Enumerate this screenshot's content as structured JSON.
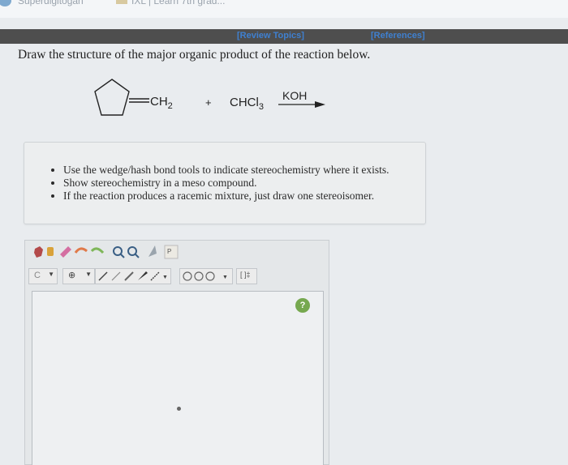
{
  "browser_tabs": [
    {
      "label": "Superdigitogan"
    },
    {
      "label": "IXL | Learn 7th grad..."
    }
  ],
  "header": {
    "review_topics": "[Review Topics]",
    "references": "[References]"
  },
  "question": {
    "prompt": "Draw the structure of the major organic product of the reaction below."
  },
  "reaction": {
    "reactant1_group": "CH",
    "reactant1_sub": "2",
    "plus": "+",
    "reactant2": "CHCl",
    "reactant2_sub": "3",
    "reagent": "KOH"
  },
  "instructions": [
    "Use the wedge/hash bond tools to indicate stereochemistry where it exists.",
    "Show stereochemistry in a meso compound.",
    "If the reaction produces a racemic mixture, just draw one stereoisomer."
  ],
  "editor": {
    "element_selector": "C",
    "charge_selector": "⊕",
    "template_label": "[ ]‡",
    "help_label": "?",
    "accent_color": "#76a84f"
  }
}
